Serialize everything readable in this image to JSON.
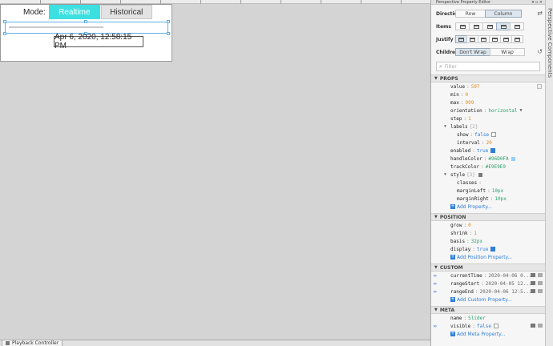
{
  "canvas": {
    "mode_label": "Mode:",
    "mode_buttons": [
      {
        "label": "Realtime",
        "active": true
      },
      {
        "label": "Historical",
        "active": false
      }
    ],
    "timestamp": "Apr 6, 2020, 12:58:15 PM",
    "bottom_tab": "Playback Controller",
    "colors": {
      "accent": "#3de0e0",
      "selection": "#5fb0e6"
    }
  },
  "panel": {
    "title": "Perspective Property Editor",
    "side_tab": "Perspective Components",
    "flex": {
      "direction_label": "Direction",
      "direction_options": [
        "Row",
        "Column"
      ],
      "direction_selected": "Column",
      "items_label": "Items",
      "justify_label": "Justify",
      "children_label": "Children",
      "children_options": [
        "Don't Wrap",
        "Wrap"
      ],
      "children_selected": "Don't Wrap"
    },
    "filter_placeholder": "Filter",
    "props": {
      "header": "PROPS",
      "value": {
        "key": "value",
        "val": "597"
      },
      "min": {
        "key": "min",
        "val": "0"
      },
      "max": {
        "key": "max",
        "val": "999"
      },
      "orientation": {
        "key": "orientation",
        "val": "horizontal"
      },
      "step": {
        "key": "step",
        "val": "1"
      },
      "labels": {
        "key": "labels",
        "count": "{2}"
      },
      "show": {
        "key": "show",
        "val": "false"
      },
      "interval": {
        "key": "interval",
        "val": "20"
      },
      "enabled": {
        "key": "enabled",
        "val": "true"
      },
      "handleColor": {
        "key": "handleColor",
        "val": "#96D0FA"
      },
      "trackColor": {
        "key": "trackColor",
        "val": "#E9E9E9"
      },
      "style": {
        "key": "style",
        "count": "{3}"
      },
      "classes": {
        "key": "classes"
      },
      "marginLeft": {
        "key": "marginLeft",
        "val": "10px"
      },
      "marginRight": {
        "key": "marginRight",
        "val": "10px"
      },
      "add": "Add Property..."
    },
    "position": {
      "header": "POSITION",
      "grow": {
        "key": "grow",
        "val": "0"
      },
      "shrink": {
        "key": "shrink",
        "val": "1"
      },
      "basis": {
        "key": "basis",
        "val": "32px"
      },
      "display": {
        "key": "display",
        "val": "true"
      },
      "add": "Add Position Property..."
    },
    "custom": {
      "header": "CUSTOM",
      "currentTime": {
        "key": "currentTime",
        "val": "2020-04-06 0..."
      },
      "rangeStart": {
        "key": "rangeStart",
        "val": "2020-04-05 12..."
      },
      "rangeEnd": {
        "key": "rangeEnd",
        "val": "2020-04-06 12:5..."
      },
      "add": "Add Custom Property..."
    },
    "meta": {
      "header": "META",
      "name": {
        "key": "name",
        "val": "Slider"
      },
      "visible": {
        "key": "visible",
        "val": "false"
      },
      "add": "Add Meta Property..."
    }
  }
}
